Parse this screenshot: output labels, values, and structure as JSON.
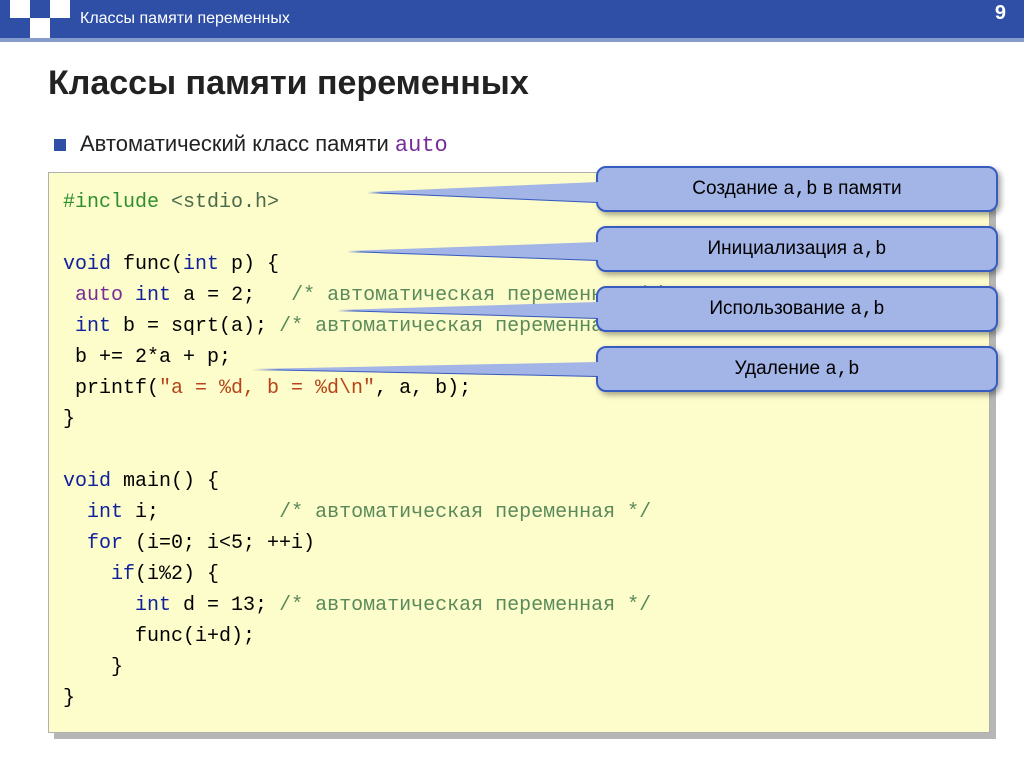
{
  "page_number": "9",
  "breadcrumb": "Классы памяти переменных",
  "title": "Классы памяти переменных",
  "bullet_text_prefix": "Автоматический класс памяти ",
  "bullet_text_keyword": "auto",
  "code": {
    "l01a": "#include",
    "l01b": "<stdio.h>",
    "l02a": "void",
    "l02b": " func(",
    "l02c": "int",
    "l02d": " p) {",
    "l03a": " ",
    "l03kw": "auto",
    "l03b": " ",
    "l03c": "int",
    "l03d": " a = 2;   ",
    "l03cm": "/* автоматическая переменная */",
    "l04a": " ",
    "l04b": "int",
    "l04c": " b = sqrt(a); ",
    "l04cm": "/* автоматическая переменная */",
    "l05": " b += 2*a + p;",
    "l06a": " printf(",
    "l06str": "\"a = %d, b = %d\\n\"",
    "l06b": ", a, b);",
    "l07": "}",
    "l09a": "void",
    "l09b": " main() {",
    "l10a": "  ",
    "l10b": "int",
    "l10c": " i;          ",
    "l10cm": "/* автоматическая переменная */",
    "l11a": "  ",
    "l11b": "for",
    "l11c": " (i=0; i<5; ++i)",
    "l12a": "    ",
    "l12b": "if",
    "l12c": "(i%2) {",
    "l13a": "      ",
    "l13b": "int",
    "l13c": " d = 13; ",
    "l13cm": "/* автоматическая переменная */",
    "l14": "      func(i+d);",
    "l15": "    }",
    "l16": "}"
  },
  "callouts": {
    "c1_pre": "Создание ",
    "c1_code": "a,b",
    "c1_post": " в памяти",
    "c2_pre": "Инициализация ",
    "c2_code": "a,b",
    "c2_post": "",
    "c3_pre": "Использование ",
    "c3_code": "a,b",
    "c3_post": "",
    "c4_pre": "Удаление ",
    "c4_code": "a,b",
    "c4_post": ""
  }
}
